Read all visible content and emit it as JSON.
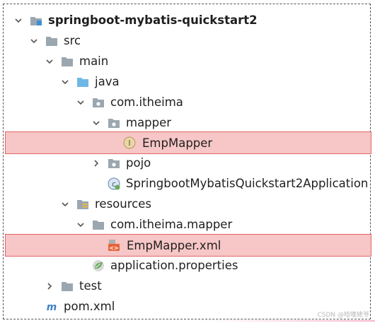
{
  "tree": {
    "project": {
      "label": "springboot-mybatis-quickstart2",
      "icon": "project-module-icon",
      "expanded": true
    },
    "src": {
      "label": "src",
      "icon": "folder-icon",
      "expanded": true
    },
    "main": {
      "label": "main",
      "icon": "folder-icon",
      "expanded": true
    },
    "java": {
      "label": "java",
      "icon": "source-root-folder-icon",
      "expanded": true
    },
    "pkg": {
      "label": "com.itheima",
      "icon": "package-icon",
      "expanded": true
    },
    "mapper": {
      "label": "mapper",
      "icon": "package-icon",
      "expanded": true
    },
    "empmapper": {
      "label": "EmpMapper",
      "icon": "interface-icon",
      "icon_text": "I",
      "highlighted": true
    },
    "pojo": {
      "label": "pojo",
      "icon": "package-icon",
      "expanded": false
    },
    "app": {
      "label": "SpringbootMybatisQuickstart2Application",
      "icon": "spring-boot-class-icon"
    },
    "resources": {
      "label": "resources",
      "icon": "resources-folder-icon",
      "expanded": true
    },
    "res_pkg": {
      "label": "com.itheima.mapper",
      "icon": "folder-icon",
      "expanded": true
    },
    "empmapper_xml": {
      "label": "EmpMapper.xml",
      "icon": "xml-file-icon",
      "icon_text": "<>",
      "highlighted": true
    },
    "props": {
      "label": "application.properties",
      "icon": "spring-properties-icon"
    },
    "test": {
      "label": "test",
      "icon": "folder-icon",
      "expanded": false
    },
    "pom": {
      "label": "pom.xml",
      "icon": "maven-icon",
      "icon_text": "m"
    }
  },
  "watermark": "CSDN @哈喽姥爷",
  "colors": {
    "highlight_bg": "#f7c6c6",
    "highlight_border": "#e36565",
    "folder": "#9aa7b0",
    "source_folder": "#6fb8e6",
    "interface_icon": "#c7a766",
    "xml_icon": "#e8643a",
    "spring": "#6aaa5e",
    "maven": "#3f7fc9"
  }
}
